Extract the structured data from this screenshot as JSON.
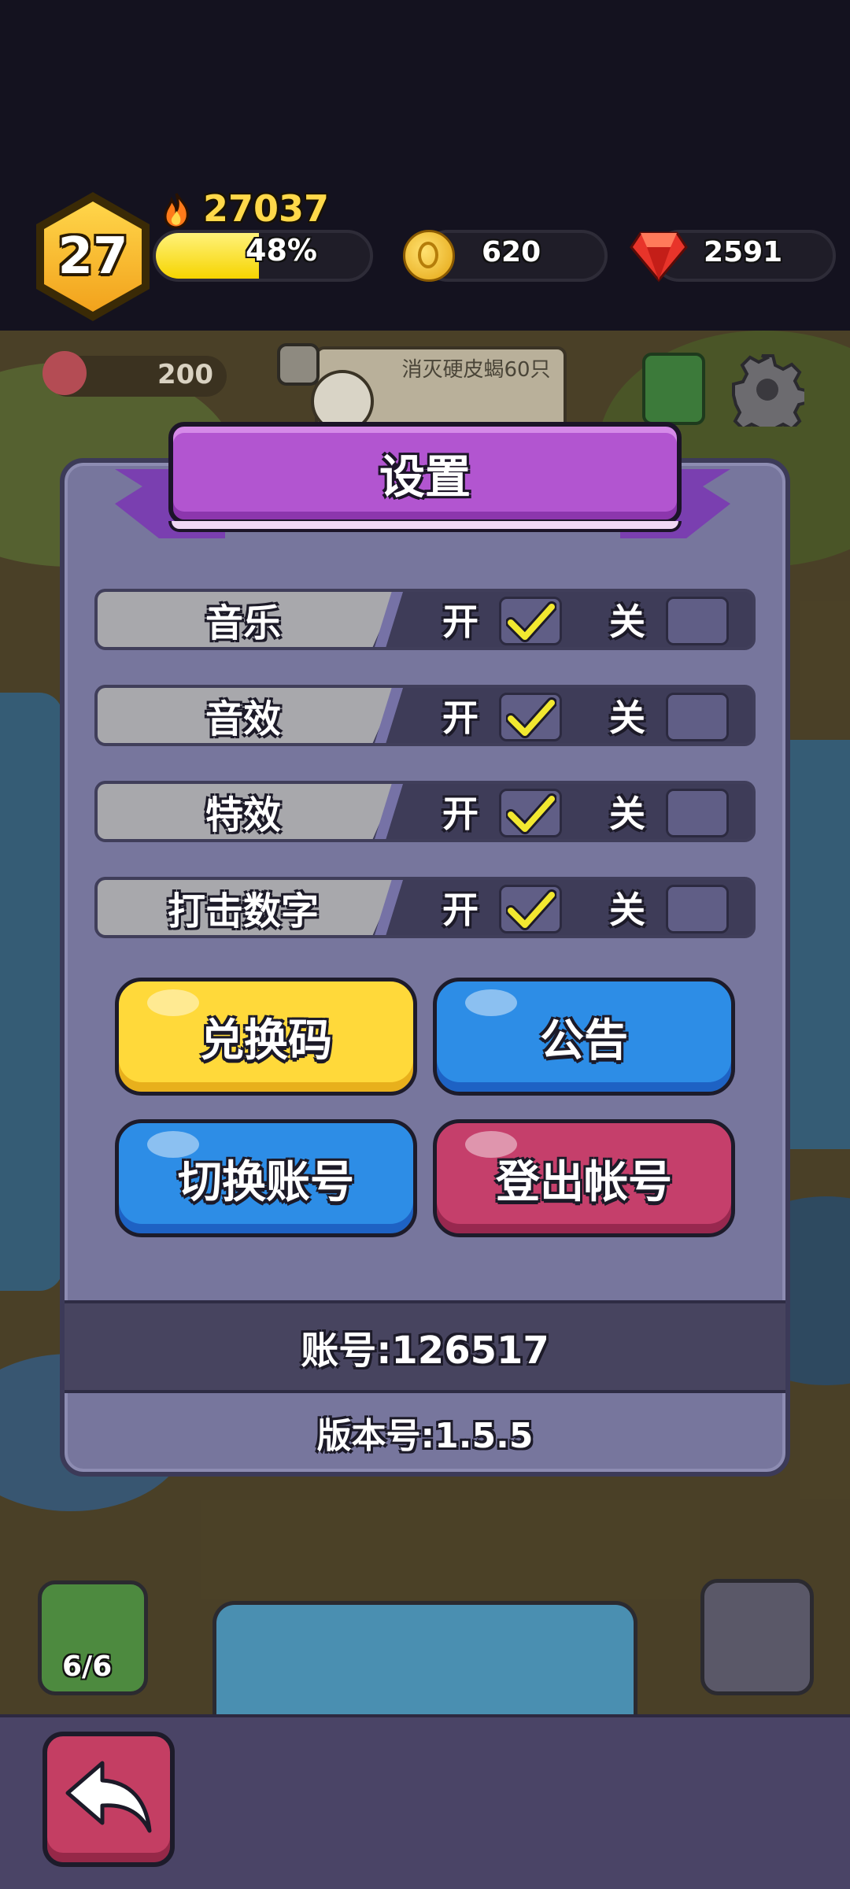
{
  "hud": {
    "level": "27",
    "score": "27037",
    "xp_percent_label": "48%",
    "xp_progress": 0.48,
    "coins": "620",
    "gems": "2591",
    "meat": "200"
  },
  "quest": {
    "text": "消灭硬皮蝎60只"
  },
  "scene": {
    "bag_count": "6/6"
  },
  "settings": {
    "title": "设置",
    "rows": [
      {
        "label": "音乐",
        "on_label": "开",
        "off_label": "关",
        "value": "on"
      },
      {
        "label": "音效",
        "on_label": "开",
        "off_label": "关",
        "value": "on"
      },
      {
        "label": "特效",
        "on_label": "开",
        "off_label": "关",
        "value": "on"
      },
      {
        "label": "打击数字",
        "on_label": "开",
        "off_label": "关",
        "value": "on"
      }
    ],
    "buttons": {
      "redeem": "兑换码",
      "notice": "公告",
      "switch_account": "切换账号",
      "logout": "登出帐号"
    },
    "account": "账号:126517",
    "version": "版本号:1.5.5"
  },
  "colors": {
    "panel": "#77769d",
    "title": "#b255d0",
    "yellow_button": "#ffd93a",
    "blue_button": "#2d8de6",
    "red_button": "#c53f6b",
    "check": "#f2e830"
  },
  "icons": [
    "flame-icon",
    "coin-icon",
    "gem-icon",
    "meat-icon",
    "search-icon",
    "skull-icon",
    "menu-icon",
    "gear-icon",
    "check-icon",
    "back-arrow-icon"
  ]
}
